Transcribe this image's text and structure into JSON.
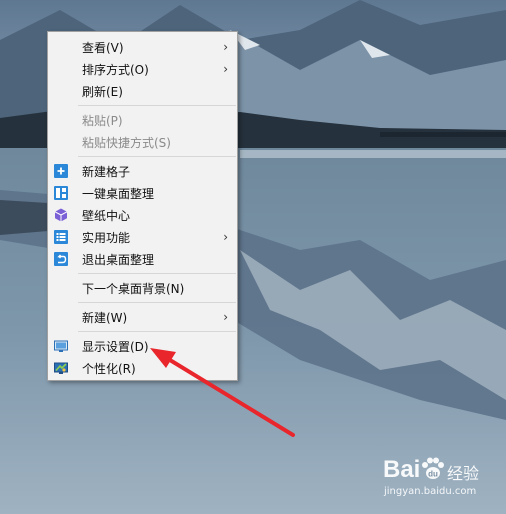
{
  "context_menu": {
    "items": [
      {
        "label": "查看(V)",
        "submenu": true,
        "disabled": false
      },
      {
        "label": "排序方式(O)",
        "submenu": true,
        "disabled": false
      },
      {
        "label": "刷新(E)",
        "submenu": false,
        "disabled": false
      },
      {
        "label": "粘贴(P)",
        "submenu": false,
        "disabled": true
      },
      {
        "label": "粘贴快捷方式(S)",
        "submenu": false,
        "disabled": true
      },
      {
        "label": "新建格子",
        "icon": "plus-icon",
        "submenu": false,
        "disabled": false
      },
      {
        "label": "一键桌面整理",
        "icon": "grid-layout-icon",
        "submenu": false,
        "disabled": false
      },
      {
        "label": "壁纸中心",
        "icon": "cube-icon",
        "submenu": false,
        "disabled": false
      },
      {
        "label": "实用功能",
        "icon": "list-icon",
        "submenu": true,
        "disabled": false
      },
      {
        "label": "退出桌面整理",
        "icon": "exit-icon",
        "submenu": false,
        "disabled": false
      },
      {
        "label": "下一个桌面背景(N)",
        "submenu": false,
        "disabled": false
      },
      {
        "label": "新建(W)",
        "submenu": true,
        "disabled": false
      },
      {
        "label": "显示设置(D)",
        "icon": "display-icon",
        "submenu": false,
        "disabled": false,
        "highlighted": true
      },
      {
        "label": "个性化(R)",
        "icon": "personalize-icon",
        "submenu": false,
        "disabled": false
      }
    ],
    "submenu_arrow": "›"
  },
  "watermark": {
    "logo_text": "Bai",
    "logo_suffix": "经验",
    "url": "jingyan.baidu.com"
  },
  "colors": {
    "menu_bg": "#f2f2f2",
    "icon_blue": "#2b88d8",
    "icon_purple": "#7b5fd6",
    "arrow_red": "#e8262b"
  }
}
